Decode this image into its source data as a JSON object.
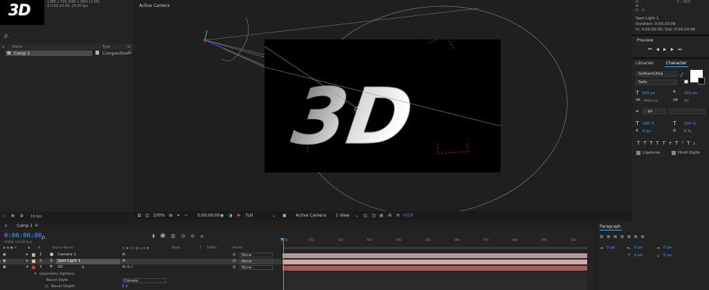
{
  "project": {
    "thumb_text": "3D",
    "meta_line1": "1280 x 720  (640 x 360) (1.00)",
    "meta_line2": "Δ 0:00:10:09, 24.00 fps",
    "search_placeholder": "ρ.",
    "col_name": "Name",
    "col_type": "Type",
    "col_size": "Si",
    "item_name": "Comp 1",
    "item_type": "Composition",
    "bpc": "16 bpc"
  },
  "viewer": {
    "title": "Active Camera",
    "zoom": "100%",
    "timecode": "0:00:00:00",
    "resolution": "Full",
    "camera": "Active Camera",
    "views": "1 View",
    "exposure": "+0.0",
    "text_3d": "3D"
  },
  "info": {
    "g_label": "G :",
    "b_label": "B :",
    "a_label": "A : 0",
    "y_label": "Y : 910",
    "layer": "Spot Light 1",
    "duration": "Duration: 0:00:10:09",
    "in_out": "In: 0:00:00:00, Out: 0:00:10:08"
  },
  "preview": {
    "title": "Preview"
  },
  "character": {
    "tab_libraries": "Libraries",
    "tab_character": "Character",
    "font": "GothamUltra",
    "style": "Italic",
    "size": "433 px",
    "leading": "150 px",
    "kerning": "Metrics",
    "tracking": "91",
    "stroke_unit": "- px",
    "vscale": "100 %",
    "hscale": "100 %",
    "baseline": "0 px",
    "tsume": "0 %",
    "ligatures": "Ligatures",
    "hindi_digits": "Hindi Digits",
    "colors": {
      "fill": "#ffffff",
      "stroke": "#000000"
    }
  },
  "timeline": {
    "tab": "Comp 1",
    "timecode": "0:00:00:00",
    "frames": "00000 (24.00 fps)",
    "col_source": "Source Name",
    "col_mode": "Mode",
    "col_t": "T",
    "col_trkmat": "TrkMat",
    "col_parent": "Parent",
    "layers": [
      {
        "num": "1",
        "name": "Camera 1",
        "parent": "None",
        "color": "#c9a8a8"
      },
      {
        "num": "2",
        "name": "Spot Light 1",
        "parent": "None",
        "color": "#e0b8b8"
      },
      {
        "num": "3",
        "name": "3D",
        "parent": "None",
        "color": "#c23a3a"
      }
    ],
    "geometry_options": "Geometry Options",
    "bevel_style_label": "Bevel Style",
    "bevel_style_value": "Convex",
    "bevel_depth_label": "Bevel Depth",
    "bevel_depth_value": "9.6",
    "ruler": [
      "0s",
      "01s",
      "02s",
      "03s",
      "04s",
      "05s",
      "06s",
      "07s",
      "08s",
      "09s",
      "10s"
    ],
    "track_colors": [
      "#b79a9a",
      "#d2aaaa",
      "#a45c5c"
    ]
  },
  "paragraph": {
    "title": "Paragraph",
    "indent_left": "0 px",
    "indent_right": "0 px",
    "indent_first": "0 px",
    "space_before": "0 px",
    "space_after": "0 px"
  }
}
